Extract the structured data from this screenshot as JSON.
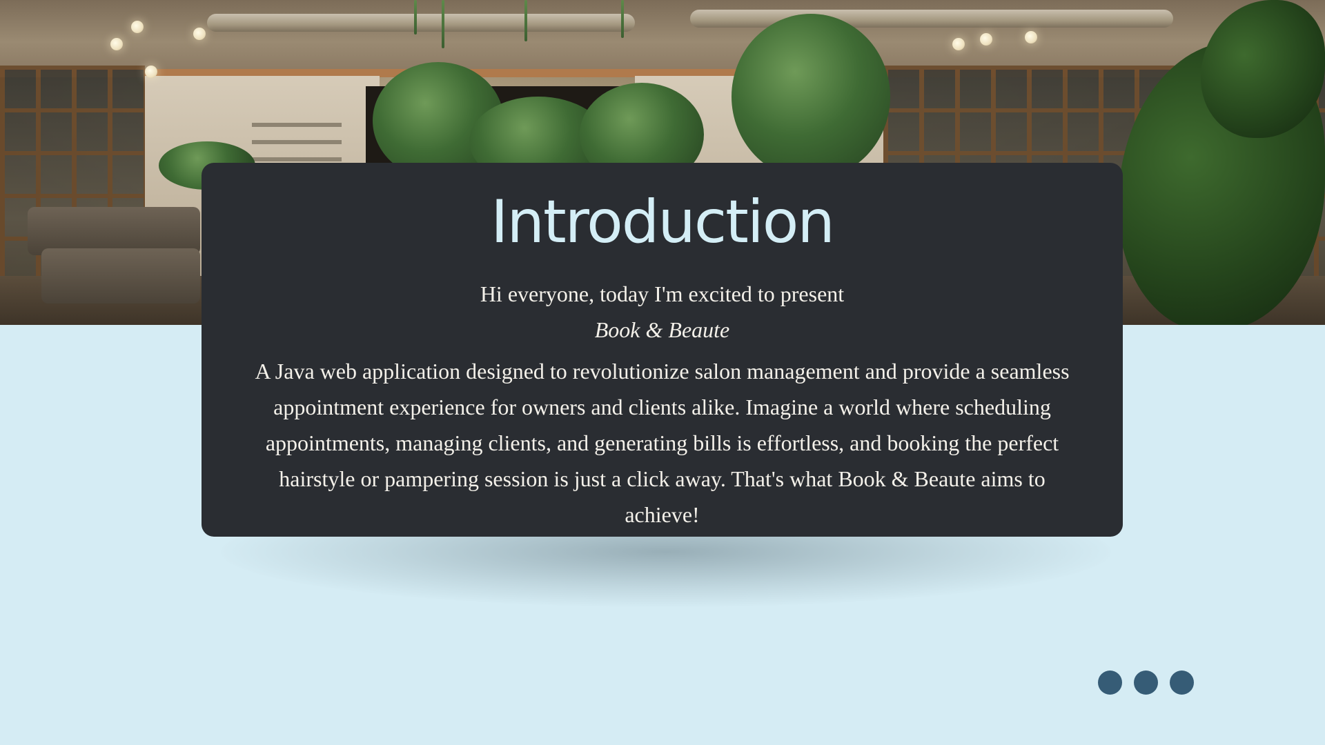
{
  "slide": {
    "title": "Introduction",
    "intro_line": "Hi everyone, today I'm excited to present",
    "app_name": "Book & Beaute",
    "body": "A Java web application designed to revolutionize salon management and provide a seamless appointment experience for owners and clients alike. Imagine a world where scheduling appointments, managing clients, and generating bills is effortless, and booking the perfect hairstyle or pampering session is just a click away. That's what Book & Beaute aims to achieve!"
  },
  "banner": {
    "description_icon": "salon-interior-photo"
  },
  "decoration": {
    "dots_count": 3,
    "dot_color": "#365c76",
    "background_color": "#d5ecf4",
    "card_color": "#2a2d32",
    "title_color": "#d4eef6"
  }
}
